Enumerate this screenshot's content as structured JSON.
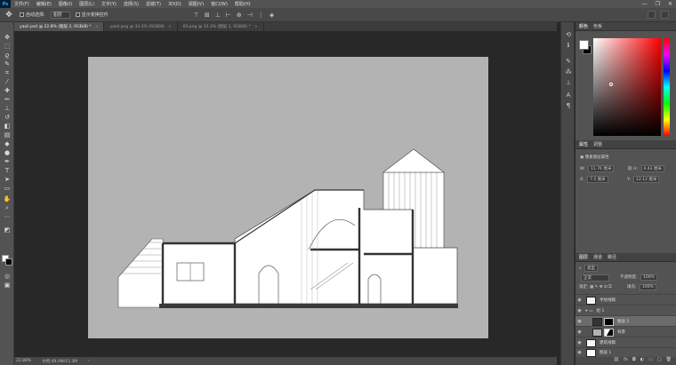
{
  "menubar": {
    "logo": "Ps",
    "items": [
      "文件(F)",
      "编辑(E)",
      "图像(I)",
      "图层(L)",
      "文字(Y)",
      "选择(S)",
      "滤镜(T)",
      "3D(D)",
      "视图(V)",
      "窗口(W)",
      "帮助(H)"
    ],
    "minimize": "—",
    "restore": "❐",
    "close": "✕"
  },
  "options": {
    "auto_select_label": "自动选择:",
    "auto_select_value": "图层",
    "transform_label": "显示变换控件"
  },
  "tabs": [
    {
      "label": "yaoli.psd @ 22.8% (图层 2, RGB/8) *",
      "active": true
    },
    {
      "label": "yaoli.png @ 33.3% (RGB/8)",
      "active": false
    },
    {
      "label": "03.png @ 33.3% (图层 1, RGB/8) *",
      "active": false
    }
  ],
  "status": {
    "zoom": "22.88%",
    "doc": "文档:49.0M/15.3M"
  },
  "color_panel": {
    "tabs": [
      "颜色",
      "色板"
    ]
  },
  "properties_panel": {
    "tabs": [
      "属性",
      "调整"
    ],
    "title": "像素图层属性",
    "w_label": "W:",
    "w_value": "11.76 厘米",
    "h_label": "H:",
    "h_value": "4.43 厘米",
    "x_label": "X:",
    "x_value": "7.5 厘米",
    "y_label": "Y:",
    "y_value": "12.12 厘米"
  },
  "layers_panel": {
    "tabs": [
      "图层",
      "通道",
      "路径"
    ],
    "filter_label": "类型",
    "blend_mode": "正常",
    "opacity_label": "不透明度:",
    "opacity_value": "100%",
    "lock_label": "锁定:",
    "fill_label": "填充:",
    "fill_value": "100%",
    "layers": [
      {
        "name": "手绘线稿",
        "type": "pixel",
        "selected": false
      },
      {
        "name": "组 1",
        "type": "group",
        "selected": false
      },
      {
        "name": "图层 2",
        "type": "masked",
        "selected": true
      },
      {
        "name": "背景",
        "type": "masked",
        "selected": false
      },
      {
        "name": "建筑线稿",
        "type": "pixel",
        "selected": false
      },
      {
        "name": "图层 1",
        "type": "pixel",
        "selected": false
      }
    ]
  }
}
